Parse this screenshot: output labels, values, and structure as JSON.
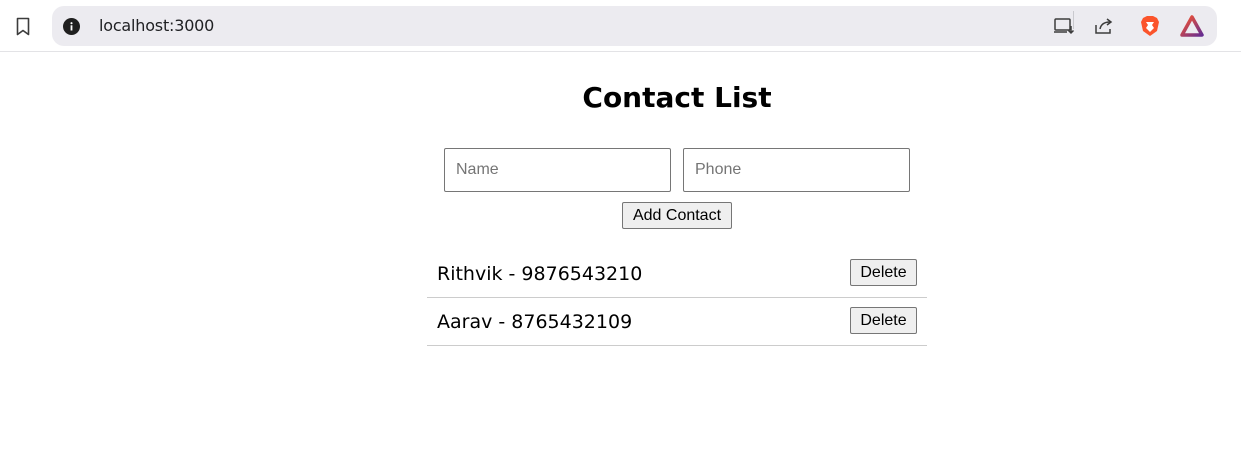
{
  "browser": {
    "url": "localhost:3000",
    "icons": [
      "bookmark-icon",
      "site-info-icon",
      "install-app-icon",
      "share-icon",
      "brave-shields-icon",
      "brave-rewards-icon"
    ],
    "colors": {
      "brave_orange": "#fb542b",
      "rewards_purple": "#662d91"
    }
  },
  "page": {
    "title": "Contact List",
    "name_input": {
      "placeholder": "Name",
      "value": ""
    },
    "phone_input": {
      "placeholder": "Phone",
      "value": ""
    },
    "add_button_label": "Add Contact",
    "contacts": [
      {
        "text": "Rithvik - 9876543210",
        "delete_label": "Delete"
      },
      {
        "text": "Aarav - 8765432109",
        "delete_label": "Delete"
      }
    ]
  }
}
